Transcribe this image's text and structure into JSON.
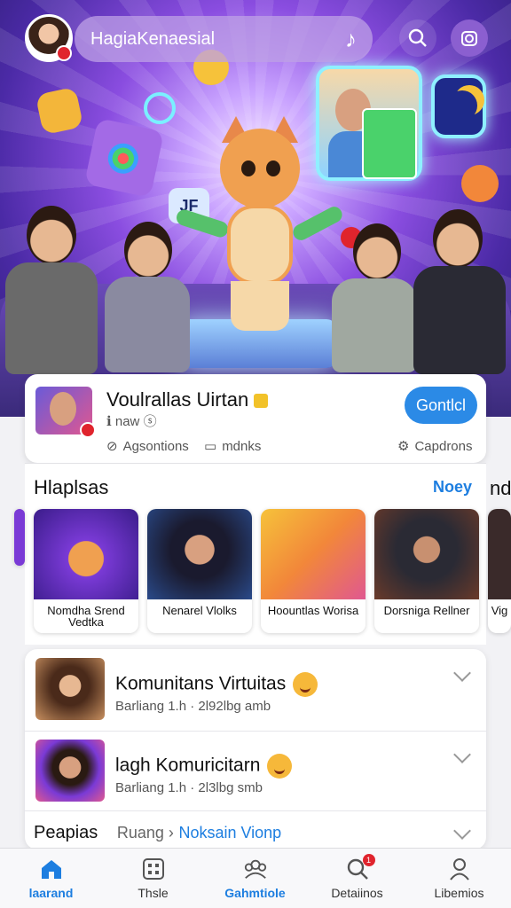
{
  "header": {
    "title": "HagiaKenaesial",
    "music_icon": "music-note-icon",
    "search_icon": "search-icon",
    "camera_icon": "camera-icon"
  },
  "hero": {
    "sign_text": "JF",
    "colors": {
      "bg_center": "#f7e9ff",
      "bg_mid": "#8a4de0",
      "bg_edge": "#2a1c6e"
    }
  },
  "profile": {
    "name": "Voulrallas Uirtan",
    "handle": "naw",
    "follow_label": "Gontlcl",
    "meta": [
      {
        "icon": "link-icon",
        "text": "Agsontions"
      },
      {
        "icon": "book-icon",
        "text": "mdnks"
      },
      {
        "icon": "gear-icon",
        "text": "Capdrons"
      }
    ]
  },
  "highlights": {
    "title": "Hlaplsas",
    "more": "Noey",
    "peek": "nd",
    "items": [
      {
        "caption": "Nomdha Srend Vedtka"
      },
      {
        "caption": "Nenarel Vlolks"
      },
      {
        "caption": "Hoountlas Worisa"
      },
      {
        "caption": "Dorsniga Rellner"
      },
      {
        "caption": "Vig"
      }
    ]
  },
  "list": {
    "rows": [
      {
        "name": "Komunitans Virtuitas",
        "sub": "Barliang   1.h · 2l92lbg   amb"
      },
      {
        "name": "lagh Komuricitarn",
        "sub": "Barliang   1.h · 2l3lbg   smb"
      }
    ],
    "footer": {
      "label": "Peapias",
      "crumb": "Ruang ›",
      "link": "Noksain Vionp"
    }
  },
  "nav": [
    {
      "label": "laarand",
      "icon": "home-icon",
      "active": true
    },
    {
      "label": "Thsle",
      "icon": "grid-icon",
      "active": false
    },
    {
      "label": "Gahmtiole",
      "icon": "community-icon",
      "active": false
    },
    {
      "label": "Detaiinos",
      "icon": "search-icon",
      "badge": "1",
      "active": false
    },
    {
      "label": "Libemios",
      "icon": "profile-icon",
      "active": false
    }
  ]
}
